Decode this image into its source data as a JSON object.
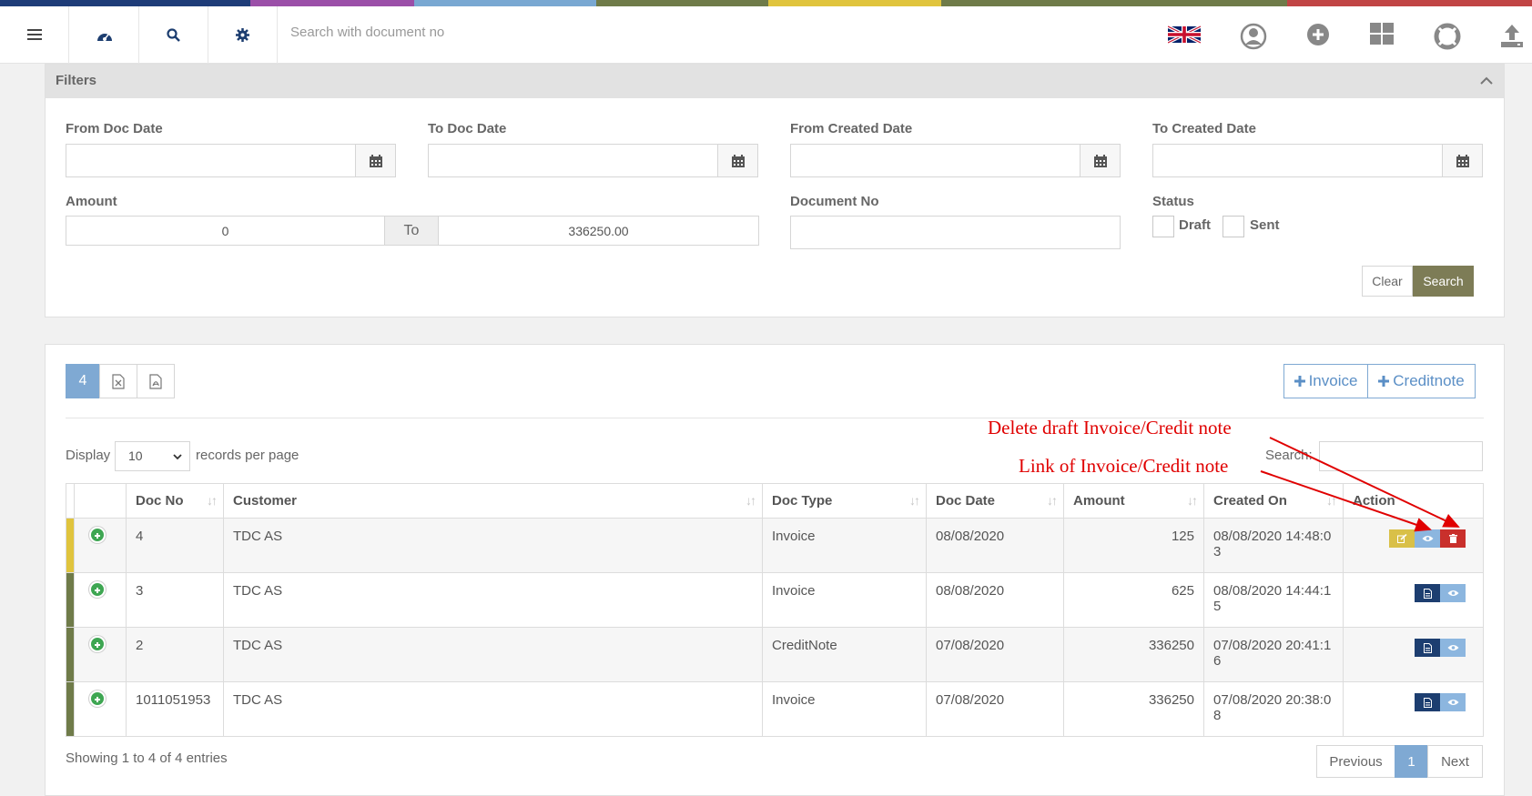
{
  "colors": {
    "strip": [
      "#1e3c78",
      "#1e3c78",
      "#9b4fa8",
      "#79a8d2",
      "#6f7b49",
      "#e0c43d",
      "#6f7b49",
      "#c14545"
    ],
    "primary": "#7fa9d3",
    "search_button": "#7d7c56",
    "draft_indicator": "#e0c43d",
    "sent_indicator": "#6f7b49",
    "annotation": "#e00000"
  },
  "topbar": {
    "search_placeholder": "Search with document no",
    "icons": [
      "hamburger-menu-icon",
      "dashboard-icon",
      "search-icon",
      "settings-icon",
      "uk-flag-icon",
      "user-profile-icon",
      "add-circle-icon",
      "apps-grid-icon",
      "support-lifebuoy-icon",
      "upload-icon"
    ]
  },
  "filters": {
    "title": "Filters",
    "from_doc_date": "From Doc Date",
    "to_doc_date": "To Doc Date",
    "from_created_date": "From Created Date",
    "to_created_date": "To Created Date",
    "amount_label": "Amount",
    "amount_from": "0",
    "amount_to_addon": "To",
    "amount_to": "336250.00",
    "document_no_label": "Document No",
    "status_label": "Status",
    "status_draft": "Draft",
    "status_sent": "Sent",
    "clear": "Clear",
    "search": "Search"
  },
  "results": {
    "count": "4",
    "add_invoice": "Invoice",
    "add_creditnote": "Creditnote",
    "display": "Display",
    "page_size": "10",
    "records_per_page": "records per page",
    "search_label": "Search:",
    "columns": [
      "Doc No",
      "Customer",
      "Doc Type",
      "Doc Date",
      "Amount",
      "Created On",
      "Action"
    ],
    "rows": [
      {
        "doc_no": "4",
        "customer": "TDC AS",
        "doc_type": "Invoice",
        "doc_date": "08/08/2020",
        "amount": "125",
        "created_on_1": "08/08/2020 14:48:0",
        "created_on_2": "3",
        "status": "draft"
      },
      {
        "doc_no": "3",
        "customer": "TDC AS",
        "doc_type": "Invoice",
        "doc_date": "08/08/2020",
        "amount": "625",
        "created_on_1": "08/08/2020 14:44:1",
        "created_on_2": "5",
        "status": "sent"
      },
      {
        "doc_no": "2",
        "customer": "TDC AS",
        "doc_type": "CreditNote",
        "doc_date": "07/08/2020",
        "amount": "336250",
        "created_on_1": "07/08/2020 20:41:1",
        "created_on_2": "6",
        "status": "sent"
      },
      {
        "doc_no": "1011051953",
        "customer": "TDC AS",
        "doc_type": "Invoice",
        "doc_date": "07/08/2020",
        "amount": "336250",
        "created_on_1": "07/08/2020 20:38:0",
        "created_on_2": "8",
        "status": "sent"
      }
    ],
    "showing": "Showing 1 to 4 of 4 entries",
    "previous": "Previous",
    "page": "1",
    "next": "Next"
  },
  "annotations": {
    "delete": "Delete draft Invoice/Credit note",
    "link": "Link of Invoice/Credit note"
  }
}
